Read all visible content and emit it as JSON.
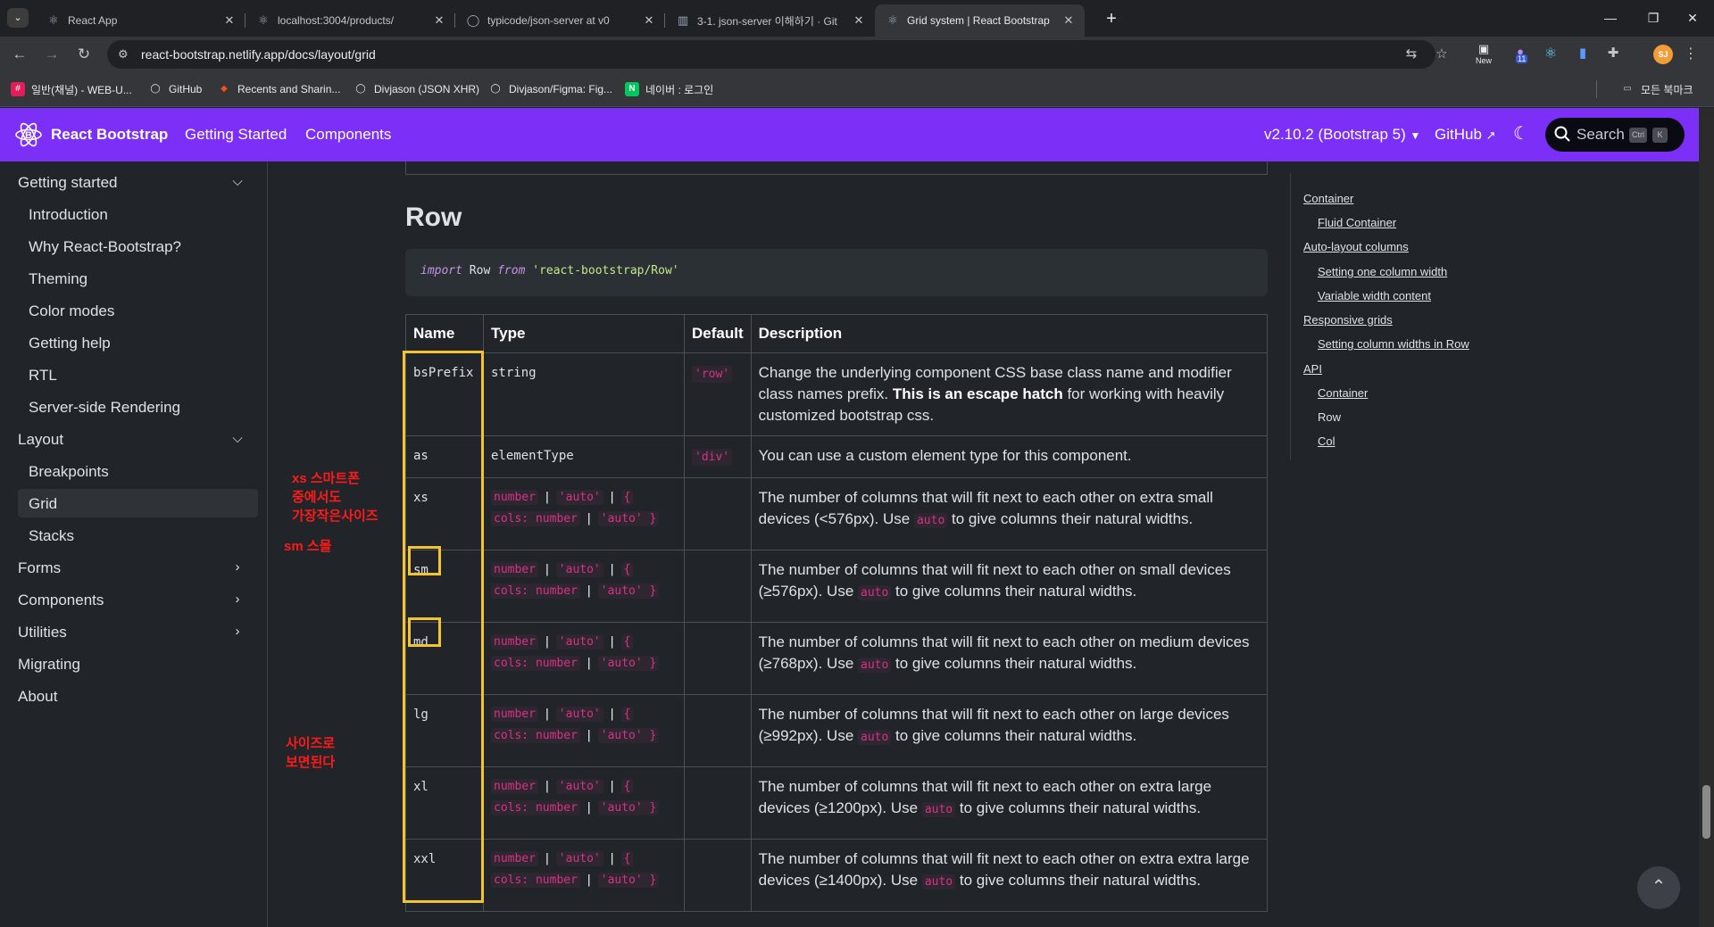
{
  "browser": {
    "tabs": [
      {
        "title": "React App",
        "favicon": "react-icon",
        "active": false
      },
      {
        "title": "localhost:3004/products/",
        "favicon": "react-icon",
        "active": false
      },
      {
        "title": "typicode/json-server at v0",
        "favicon": "github-icon",
        "active": false
      },
      {
        "title": "3-1. json-server 이해하기 · Git",
        "favicon": "book-icon",
        "active": false
      },
      {
        "title": "Grid system | React Bootstrap",
        "favicon": "react-bootstrap-icon",
        "active": true
      }
    ],
    "url": "react-bootstrap.netlify.app/docs/layout/grid",
    "extension_badge": "11",
    "profile_initials": "SJ",
    "new_label": "New",
    "bookmarks": [
      "일반(채널) - WEB-U...",
      "GitHub",
      "Recents and Sharin...",
      "Divjason (JSON XHR)",
      "Divjason/Figma: Fig...",
      "네이버 : 로그인"
    ],
    "all_bookmarks": "모든 북마크"
  },
  "site": {
    "brand": "React Bootstrap",
    "nav": [
      "Getting Started",
      "Components"
    ],
    "version": "v2.10.2 (Bootstrap 5)",
    "github": "GitHub",
    "search": "Search",
    "search_keys": [
      "Ctrl",
      "K"
    ],
    "accent": "#7b2ff7"
  },
  "sidebar": {
    "getting_started": "Getting started",
    "getting_started_items": [
      "Introduction",
      "Why React-Bootstrap?",
      "Theming",
      "Color modes",
      "Getting help",
      "RTL",
      "Server-side Rendering"
    ],
    "layout": "Layout",
    "layout_items": [
      "Breakpoints",
      "Grid",
      "Stacks"
    ],
    "forms": "Forms",
    "components": "Components",
    "utilities": "Utilities",
    "migrating": "Migrating",
    "about": "About"
  },
  "annotations": {
    "xs_note": [
      "xs 스마트폰",
      "중에서도",
      "가장작은사이즈"
    ],
    "sm_note": "sm 스몰",
    "size_note": [
      "사이즈로",
      "보면된다"
    ]
  },
  "main": {
    "heading": "Row",
    "import_code": {
      "kw1": "import",
      "name": "Row",
      "kw2": "from",
      "path": "'react-bootstrap/Row'"
    },
    "table_headers": [
      "Name",
      "Type",
      "Default",
      "Description"
    ],
    "type_tokens": {
      "number": "number",
      "auto": "'auto'",
      "lbrace": "{",
      "cols": "cols: number",
      "autoend": "'auto' }",
      "pipe": "|"
    },
    "rows": [
      {
        "name": "bsPrefix",
        "type": "string",
        "default": "'row'",
        "desc_a": "Change the underlying component CSS base class name and modifier class names prefix. ",
        "desc_b": "This is an escape hatch",
        "desc_c": " for working with heavily customized bootstrap css."
      },
      {
        "name": "as",
        "type": "elementType",
        "default": "'div'",
        "desc": "You can use a custom element type for this component."
      },
      {
        "name": "xs",
        "desc_a": "The number of columns that will fit next to each other on extra small devices (<576px). Use ",
        "code": "auto",
        "desc_b": " to give columns their natural widths."
      },
      {
        "name": "sm",
        "desc_a": "The number of columns that will fit next to each other on small devices (≥576px). Use ",
        "code": "auto",
        "desc_b": " to give columns their natural widths."
      },
      {
        "name": "md",
        "desc_a": "The number of columns that will fit next to each other on medium devices (≥768px). Use ",
        "code": "auto",
        "desc_b": " to give columns their natural widths."
      },
      {
        "name": "lg",
        "desc_a": "The number of columns that will fit next to each other on large devices (≥992px). Use ",
        "code": "auto",
        "desc_b": " to give columns their natural widths."
      },
      {
        "name": "xl",
        "desc_a": "The number of columns that will fit next to each other on extra large devices (≥1200px). Use ",
        "code": "auto",
        "desc_b": " to give columns their natural widths."
      },
      {
        "name": "xxl",
        "desc_a": "The number of columns that will fit next to each other on extra extra large devices (≥1400px). Use ",
        "code": "auto",
        "desc_b": " to give columns their natural widths."
      }
    ]
  },
  "toc": {
    "items": [
      {
        "label": "Container",
        "level": "top"
      },
      {
        "label": "Fluid Container",
        "level": "sub"
      },
      {
        "label": "Auto-layout columns",
        "level": "top"
      },
      {
        "label": "Setting one column width",
        "level": "sub"
      },
      {
        "label": "Variable width content",
        "level": "sub"
      },
      {
        "label": "Responsive grids",
        "level": "top"
      },
      {
        "label": "Setting column widths in Row",
        "level": "sub"
      },
      {
        "label": "API",
        "level": "top"
      },
      {
        "label": "Container",
        "level": "sub"
      },
      {
        "label": "Row",
        "level": "sub"
      },
      {
        "label": "Col",
        "level": "sub"
      }
    ]
  }
}
